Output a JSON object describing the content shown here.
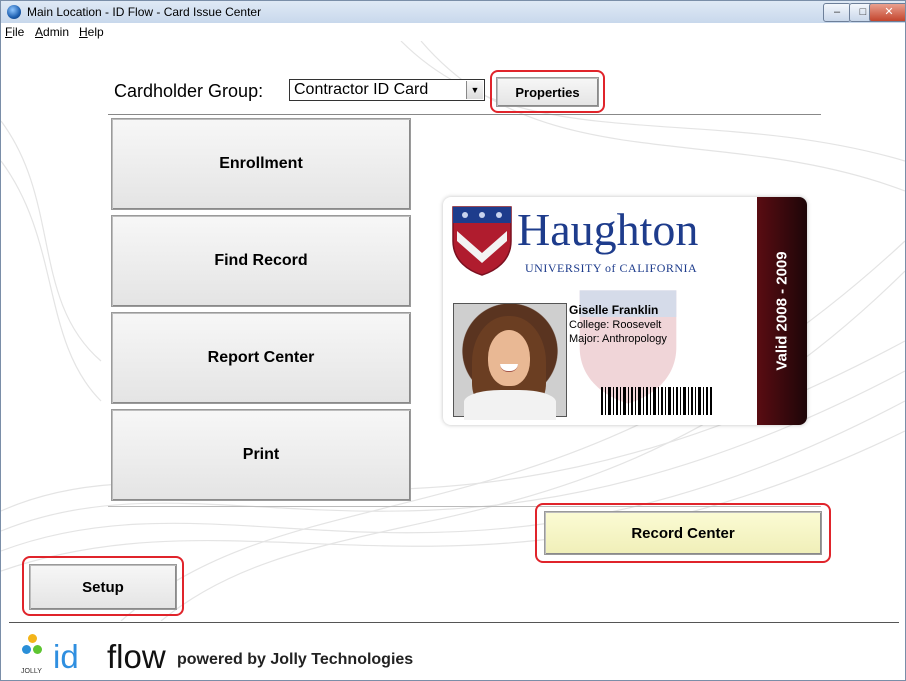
{
  "window": {
    "title": "Main Location - ID Flow - Card Issue Center",
    "controls": {
      "minimize": "–",
      "maximize": "□",
      "close": "✕"
    }
  },
  "menu": [
    {
      "label": "File",
      "accel": "F",
      "rest": "ile"
    },
    {
      "label": "Admin",
      "accel": "A",
      "rest": "dmin"
    },
    {
      "label": "Help",
      "accel": "H",
      "rest": "elp"
    }
  ],
  "cardholder_group": {
    "label": "Cardholder Group:",
    "selected": "Contractor ID Card",
    "properties_label": "Properties"
  },
  "main_buttons": {
    "enrollment": "Enrollment",
    "find_record": "Find Record",
    "report_center": "Report Center",
    "print": "Print"
  },
  "card_preview": {
    "university": "Haughton",
    "subtitle": "UNIVERSITY of CALIFORNIA",
    "name": "Giselle Franklin",
    "college": "College: Roosevelt",
    "major": "Major: Anthropology",
    "valid": "Valid 2008 - 2009",
    "band_color": "#5a0c12",
    "brand_color": "#1e3c8c"
  },
  "record_center_label": "Record Center",
  "setup_label": "Setup",
  "footer": {
    "logo_caption": "JOLLY",
    "id": "id",
    "flow": "flow",
    "powered": "powered by Jolly Technologies",
    "accent": "#2f8fe0"
  },
  "highlight_color": "#e0242b"
}
